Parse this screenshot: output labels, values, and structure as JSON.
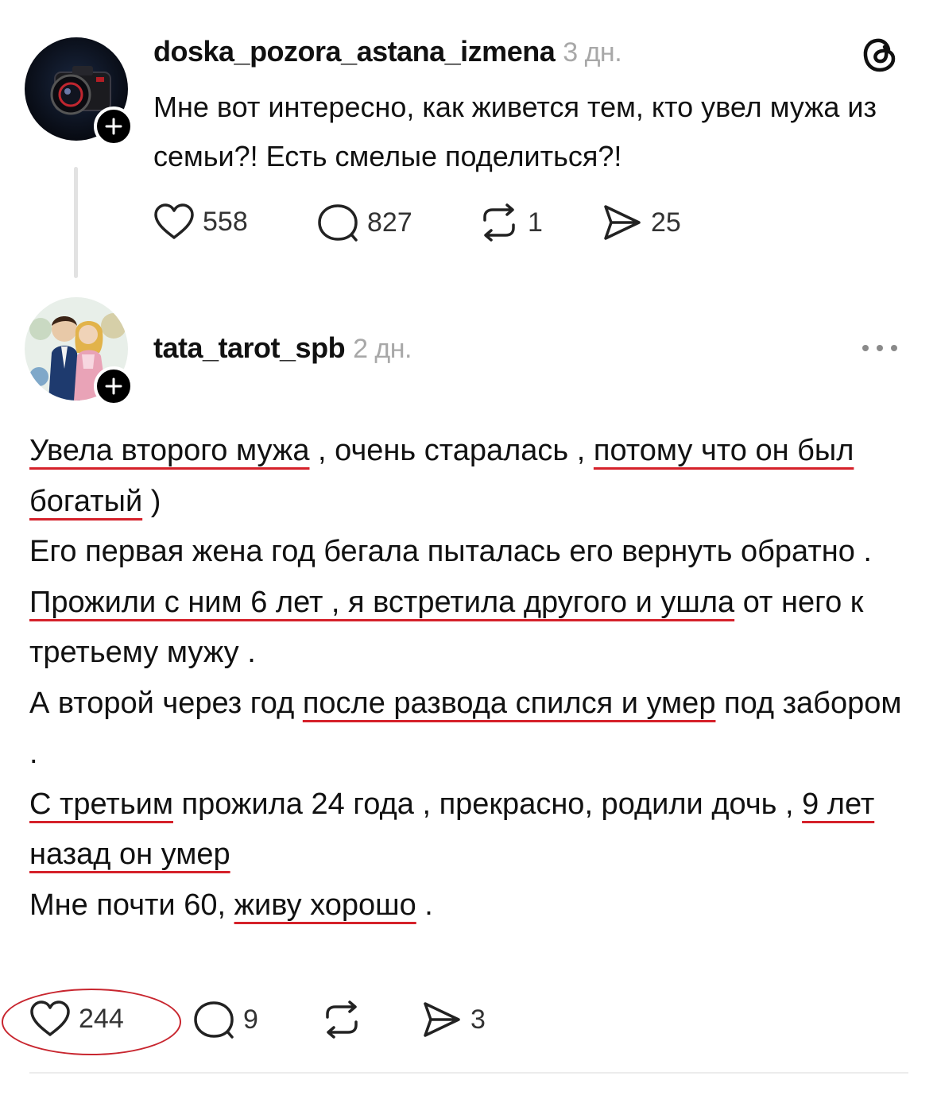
{
  "post1": {
    "username": "doska_pozora_astana_izmena",
    "time": "3 дн.",
    "text": "Мне вот интересно, как живется тем, кто увел мужа из семьи?! Есть смелые поделиться?!",
    "likes": "558",
    "comments": "827",
    "reposts": "1",
    "shares": "25"
  },
  "post2": {
    "username": "tata_tarot_spb",
    "time": "2 дн.",
    "segments": {
      "s1": "Увела второго мужа",
      "s2": " , очень старалась , ",
      "s3": "потому что он был богатый",
      "s4": " )",
      "s5": "Его первая жена год бегала пыталась его вернуть обратно .",
      "s6": "Прожили с ним 6 лет , я встретила другого и ушла",
      "s7": " от него к третьему мужу .",
      "s8": "А второй через год ",
      "s9": "после развода спился и умер",
      "s10": " под забором .",
      "s11": "С третьим",
      "s12": " прожила 24 года , прекрасно, родили дочь , ",
      "s13": "9 лет назад он умер",
      "s14": "Мне почти 60, ",
      "s15": "живу хорошо",
      "s16": " ."
    },
    "likes": "244",
    "comments": "9",
    "reposts": "",
    "shares": "3"
  },
  "icons": {
    "threads_logo": "threads-logo-icon",
    "more": "more-options-icon",
    "like": "heart-icon",
    "comment": "comment-icon",
    "repost": "repost-icon",
    "share": "share-icon",
    "follow": "plus-icon"
  },
  "colors": {
    "annotation_red": "#d5212a",
    "muted_text": "#a8a8a8",
    "text": "#111111"
  }
}
